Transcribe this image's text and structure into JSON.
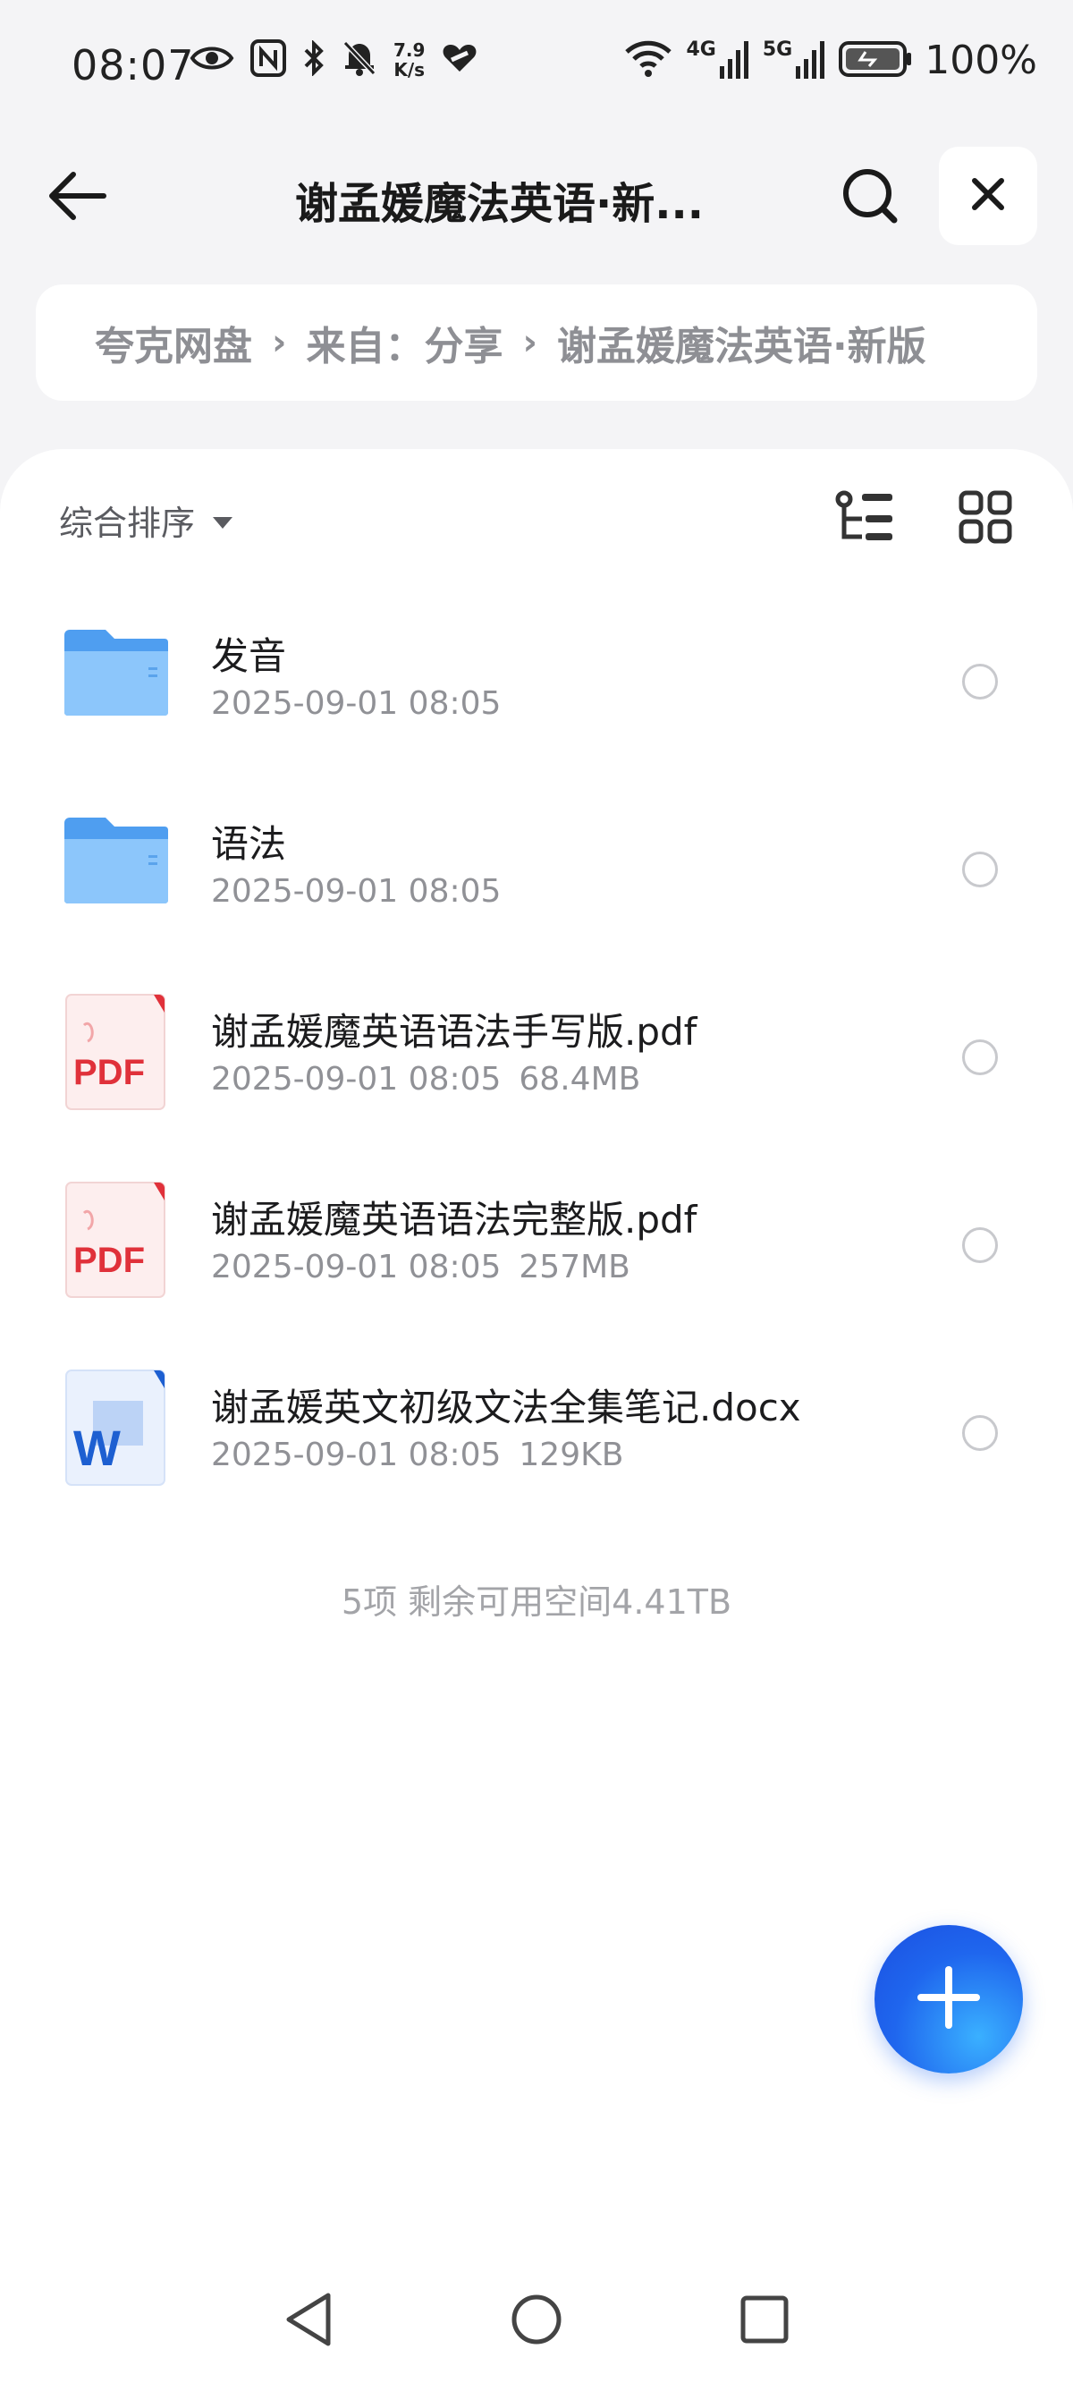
{
  "status_bar": {
    "time": "08:07",
    "net_speed_value": "7.9",
    "net_speed_unit": "K/s",
    "net_4g_label": "4G",
    "net_5g_label": "5G",
    "battery_percent": "100%",
    "icons": [
      "eye-icon",
      "nfc-icon",
      "bluetooth-icon",
      "mute-bell-icon",
      "heart-icon",
      "wifi-icon",
      "signal-icon",
      "battery-icon"
    ]
  },
  "header": {
    "title": "谢孟媛魔法英语·新...",
    "back_icon": "back-arrow-icon",
    "search_icon": "search-icon",
    "close_icon": "close-icon"
  },
  "breadcrumb": {
    "items": [
      "夸克网盘",
      "来自：分享",
      "谢孟媛魔法英语·新版"
    ]
  },
  "toolbar": {
    "sort_label": "综合排序",
    "tree_icon": "tree-view-icon",
    "grid_icon": "grid-view-icon"
  },
  "files": [
    {
      "name": "发音",
      "date": "2025-09-01 08:05",
      "size": "",
      "type": "folder"
    },
    {
      "name": "语法",
      "date": "2025-09-01 08:05",
      "size": "",
      "type": "folder"
    },
    {
      "name": "谢孟媛魔英语语法手写版.pdf",
      "date": "2025-09-01 08:05",
      "size": "68.4MB",
      "type": "pdf"
    },
    {
      "name": "谢孟媛魔英语语法完整版.pdf",
      "date": "2025-09-01 08:05",
      "size": "257MB",
      "type": "pdf"
    },
    {
      "name": "谢孟媛英文初级文法全集笔记.docx",
      "date": "2025-09-01 08:05",
      "size": "129KB",
      "type": "docx"
    }
  ],
  "pdf_icon_label": "PDF",
  "docx_icon_label": "W",
  "summary": "5项 剩余可用空间4.41TB",
  "colors": {
    "accent": "#1f66ee",
    "folder": "#5aa9f2",
    "pdf": "#e0313a",
    "docx": "#1d5fd1"
  }
}
